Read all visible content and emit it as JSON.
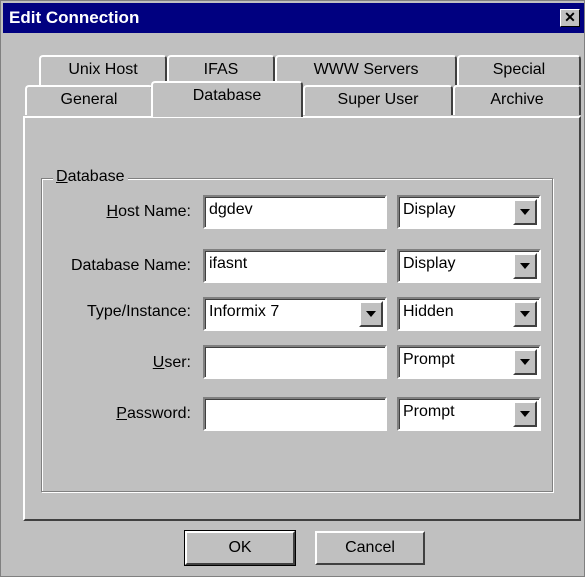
{
  "window": {
    "title": "Edit Connection",
    "close_glyph": "✕"
  },
  "tabs_back": [
    "Unix Host",
    "IFAS",
    "WWW Servers",
    "Special"
  ],
  "tabs_front": [
    "General",
    "Database",
    "Super User",
    "Archive"
  ],
  "active_tab": "Database",
  "group": {
    "label_first": "D",
    "label_rest": "atabase"
  },
  "fields": {
    "host_name": {
      "label_u": "H",
      "label_rest": "ost Name:",
      "value": "dgdev",
      "mode": "Display"
    },
    "database_name": {
      "label": "Database Name:",
      "value": "ifasnt",
      "mode": "Display"
    },
    "type_instance": {
      "label": "Type/Instance:",
      "value": "Informix 7",
      "mode": "Hidden"
    },
    "user": {
      "label_u": "U",
      "label_rest": "ser:",
      "value": "",
      "mode": "Prompt"
    },
    "password": {
      "label_u": "P",
      "label_rest": "assword:",
      "value": "",
      "mode": "Prompt"
    }
  },
  "buttons": {
    "ok": "OK",
    "cancel": "Cancel"
  },
  "colors": {
    "titlebar": "#000080",
    "face": "#c0c0c0"
  }
}
